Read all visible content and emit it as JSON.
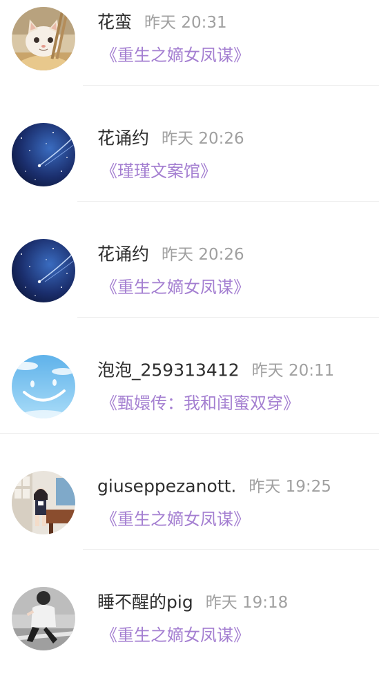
{
  "messages": [
    {
      "name": "花蛮",
      "time": "昨天 20:31",
      "title": "《重生之嫡女凤谋》",
      "avatar": "cat-avatar-icon"
    },
    {
      "name": "花诵约",
      "time": "昨天 20:26",
      "title": "《瑾瑾文案馆》",
      "avatar": "starry-sky-avatar-icon"
    },
    {
      "name": "花诵约",
      "time": "昨天 20:26",
      "title": "《重生之嫡女凤谋》",
      "avatar": "starry-sky-avatar-icon"
    },
    {
      "name": "泡泡_259313412",
      "time": "昨天 20:11",
      "title": "《甄嬛传：我和闺蜜双穿》",
      "avatar": "blue-sky-avatar-icon"
    },
    {
      "name": "giuseppezanott.",
      "time": "昨天 19:25",
      "title": "《重生之嫡女凤谋》",
      "avatar": "anime-girl-avatar-icon"
    },
    {
      "name": "睡不醒的pig",
      "time": "昨天 19:18",
      "title": "《重生之嫡女凤谋》",
      "avatar": "photo-person-avatar-icon"
    }
  ],
  "colors": {
    "name": "#2e2e2e",
    "time": "#a0a0a0",
    "title": "#a47fd1",
    "divider": "#ececec",
    "background": "#ffffff"
  }
}
